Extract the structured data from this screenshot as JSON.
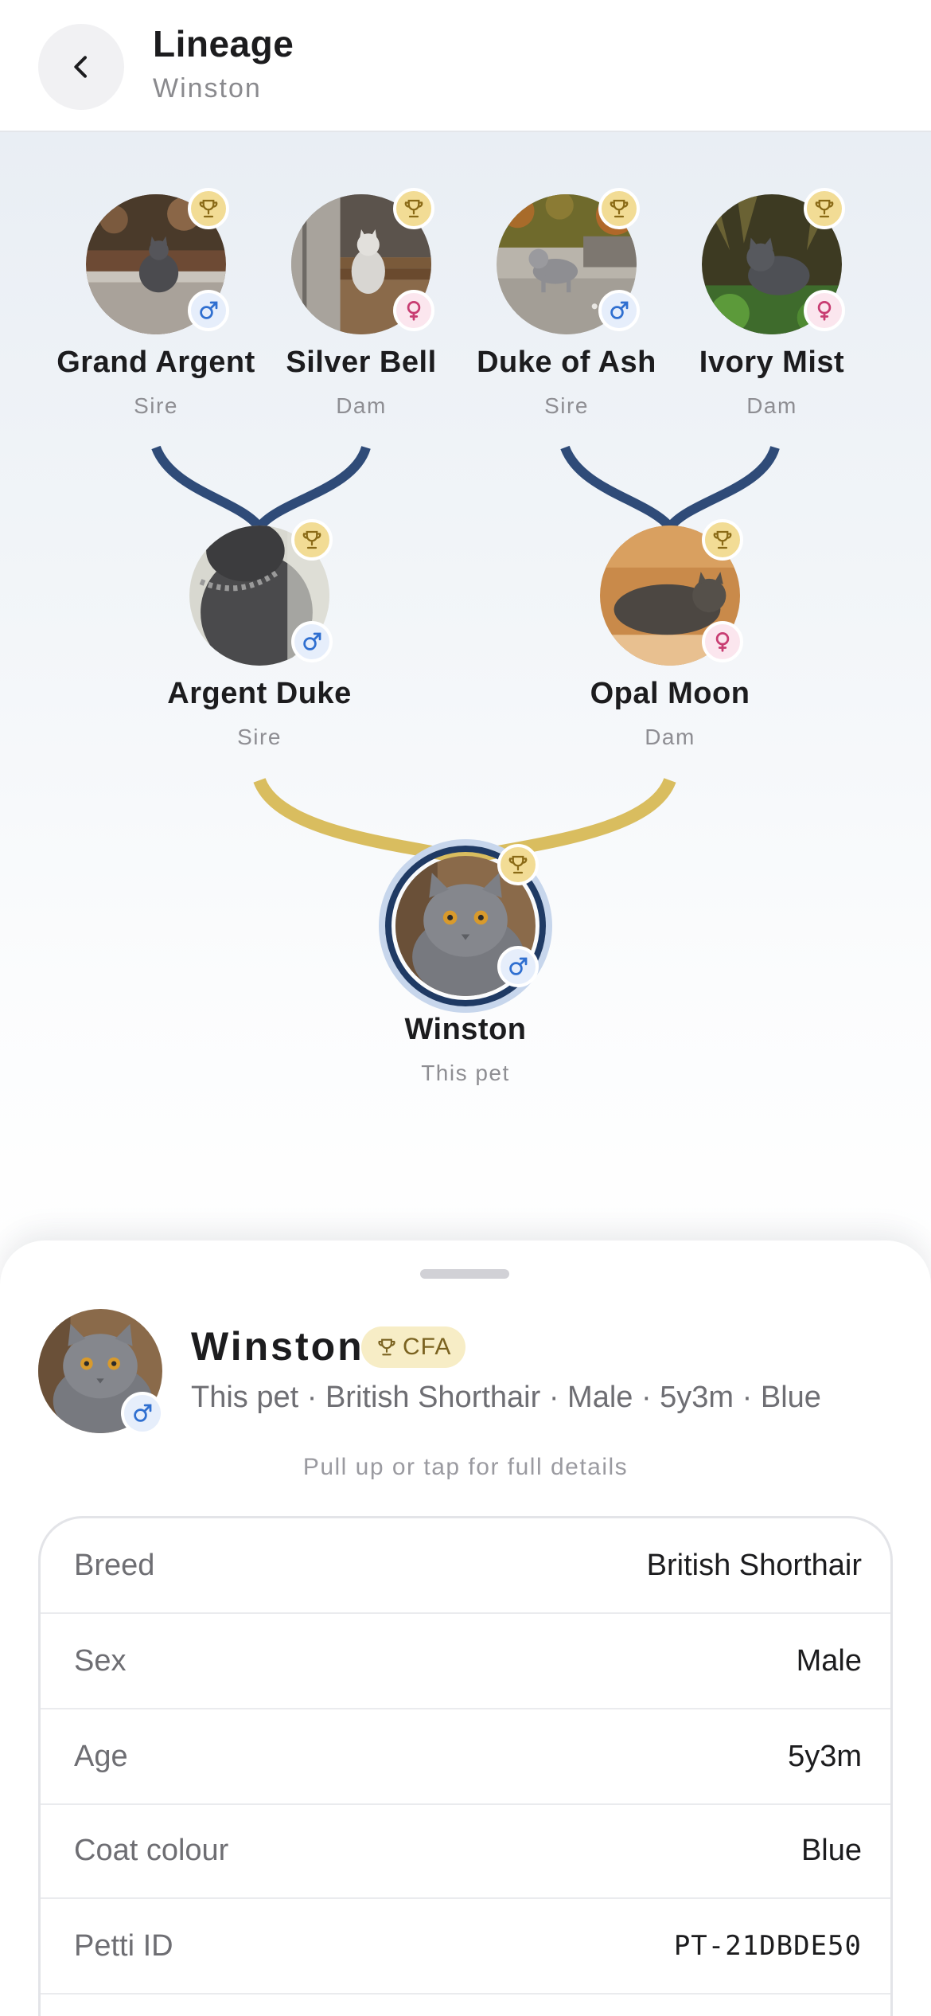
{
  "header": {
    "title": "Lineage",
    "subtitle": "Winston"
  },
  "icons": {
    "back": "chevron-left-icon",
    "trophy": "trophy-icon",
    "male": "male-symbol-icon",
    "female": "female-symbol-icon"
  },
  "colors": {
    "sire_connector": "#2f4b78",
    "parent_connector": "#d9bd5f",
    "male_badge": "#2f6fd0",
    "female_badge": "#c83d72",
    "trophy_badge": "#f2dc95"
  },
  "tree": {
    "grandparents": [
      {
        "name": "Grand Argent",
        "role": "Sire",
        "sex": "male",
        "champion": true
      },
      {
        "name": "Silver Bell",
        "role": "Dam",
        "sex": "female",
        "champion": true
      },
      {
        "name": "Duke of Ash",
        "role": "Sire",
        "sex": "male",
        "champion": true
      },
      {
        "name": "Ivory Mist",
        "role": "Dam",
        "sex": "female",
        "champion": true
      }
    ],
    "parents": [
      {
        "name": "Argent Duke",
        "role": "Sire",
        "sex": "male",
        "champion": true
      },
      {
        "name": "Opal Moon",
        "role": "Dam",
        "sex": "female",
        "champion": true
      }
    ],
    "pet": {
      "name": "Winston",
      "role": "This pet",
      "sex": "male",
      "champion": true
    }
  },
  "sheet": {
    "name": "Winston",
    "badge": "CFA",
    "meta": "This pet · British Shorthair · Male · 5y3m · Blue",
    "hint": "Pull up or tap for full details",
    "details": [
      {
        "label": "Breed",
        "value": "British Shorthair"
      },
      {
        "label": "Sex",
        "value": "Male"
      },
      {
        "label": "Age",
        "value": "5y3m"
      },
      {
        "label": "Coat colour",
        "value": "Blue"
      },
      {
        "label": "Petti ID",
        "value": "PT-21DBDE50"
      }
    ]
  }
}
